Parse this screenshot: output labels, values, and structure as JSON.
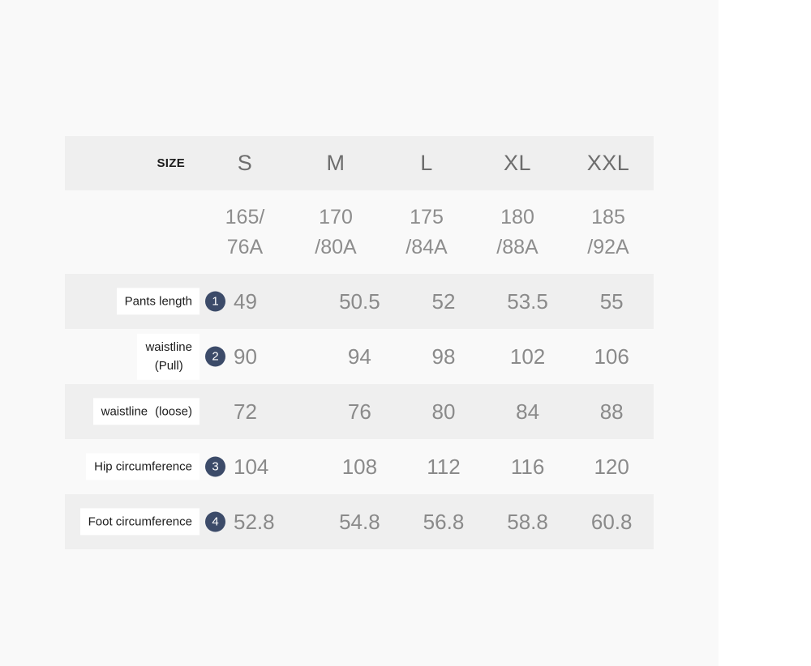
{
  "table": {
    "size_header_label": "SIZE",
    "columns": [
      "S",
      "M",
      "L",
      "XL",
      "XXL"
    ],
    "size_codes": [
      {
        "line1": "165/",
        "line2": "76A"
      },
      {
        "line1": "170",
        "line2": "/80A"
      },
      {
        "line1": "175",
        "line2": "/84A"
      },
      {
        "line1": "180",
        "line2": "/88A"
      },
      {
        "line1": "185",
        "line2": "/92A"
      }
    ],
    "rows": [
      {
        "label_line1": "Pants length",
        "label_line2": "",
        "badge": "1",
        "values": [
          "49",
          "50.5",
          "52",
          "53.5",
          "55"
        ]
      },
      {
        "label_line1": "waistline",
        "label_line2": "(Pull)",
        "badge": "2",
        "values": [
          "90",
          "94",
          "98",
          "102",
          "106"
        ]
      },
      {
        "label_line1": "waistline",
        "label_line2": "(loose)",
        "badge": "",
        "values": [
          "72",
          "76",
          "80",
          "84",
          "88"
        ]
      },
      {
        "label_line1": "Hip circumference",
        "label_line2": "",
        "badge": "3",
        "values": [
          "104",
          "108",
          "112",
          "116",
          "120"
        ]
      },
      {
        "label_line1": "Foot circumference",
        "label_line2": "",
        "badge": "4",
        "values": [
          "52.8",
          "54.8",
          "56.8",
          "58.8",
          "60.8"
        ]
      }
    ]
  },
  "colors": {
    "badge_navy": "#3c4b69",
    "row_shade_dark": "#efefef",
    "row_shade_light": "#f9f9f9",
    "value_text": "#8a8a8a",
    "label_text": "#1c1c1c"
  }
}
